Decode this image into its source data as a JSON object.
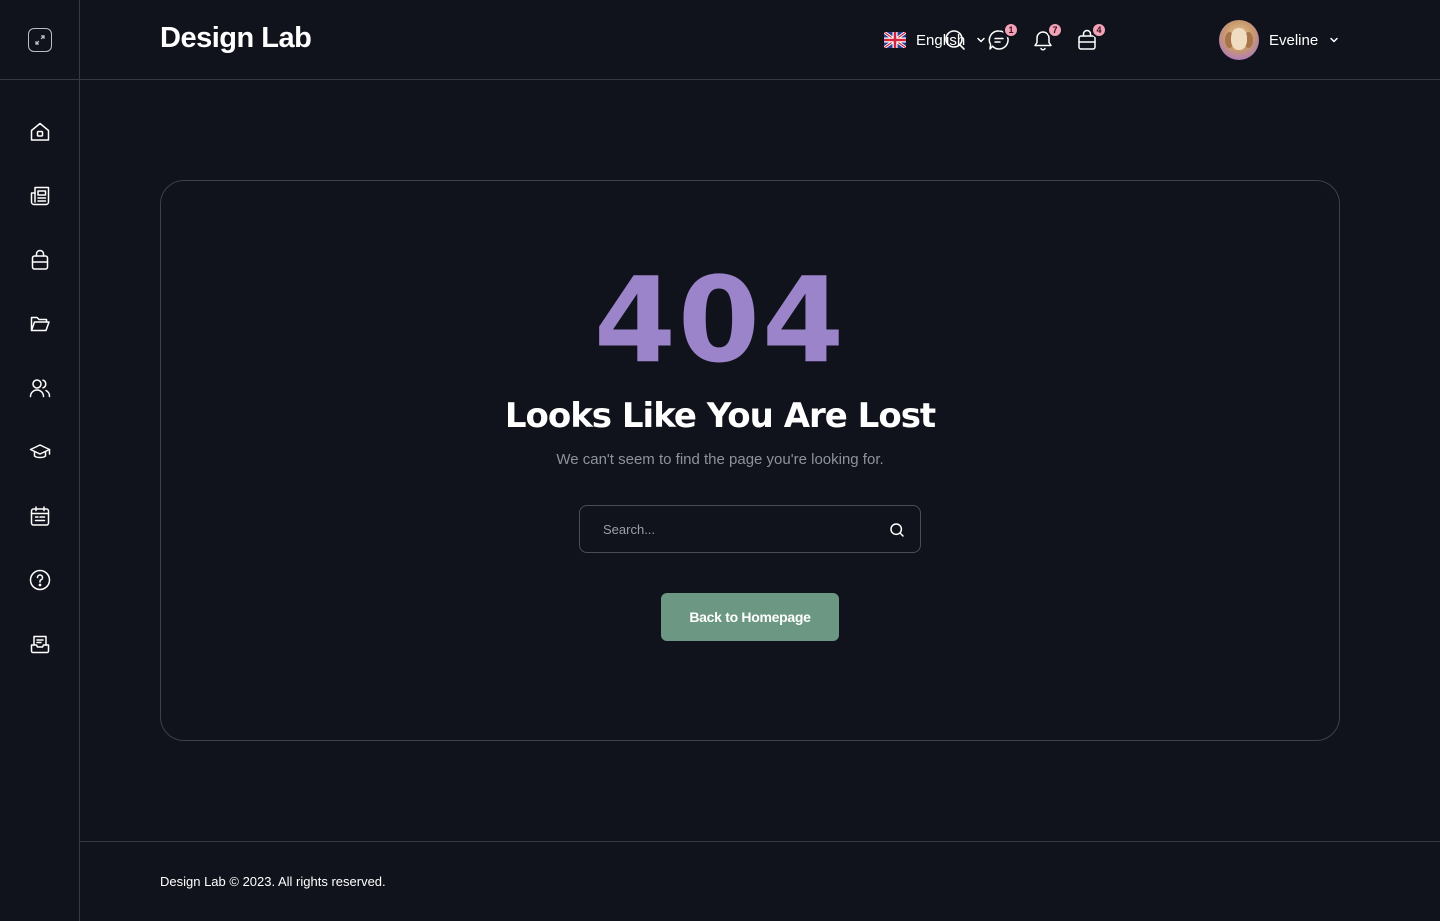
{
  "brand": {
    "name": "Design Lab"
  },
  "sidebar": {
    "items": [
      {
        "icon": "home-icon"
      },
      {
        "icon": "newspaper-icon"
      },
      {
        "icon": "shopping-bag-icon"
      },
      {
        "icon": "folder-open-icon"
      },
      {
        "icon": "users-icon"
      },
      {
        "icon": "graduation-cap-icon"
      },
      {
        "icon": "calendar-icon"
      },
      {
        "icon": "help-circle-icon"
      },
      {
        "icon": "inbox-icon"
      }
    ]
  },
  "header": {
    "language": {
      "label": "English",
      "flag": "uk-flag-icon"
    },
    "messages_badge": "1",
    "notifications_badge": "7",
    "cart_badge": "4",
    "user": {
      "name": "Eveline"
    }
  },
  "main": {
    "code": "404",
    "headline": "Looks Like You Are Lost",
    "subtext": "We can't seem to find the page you're looking for.",
    "search_placeholder": "Search...",
    "button_label": "Back to Homepage"
  },
  "footer": {
    "text": "Design Lab © 2023. All rights reserved."
  },
  "colors": {
    "background": "#10131b",
    "accent_purple": "#9b84c9",
    "button_green": "#6c9883",
    "badge_pink": "#f3a3b8",
    "border": "#363944"
  }
}
